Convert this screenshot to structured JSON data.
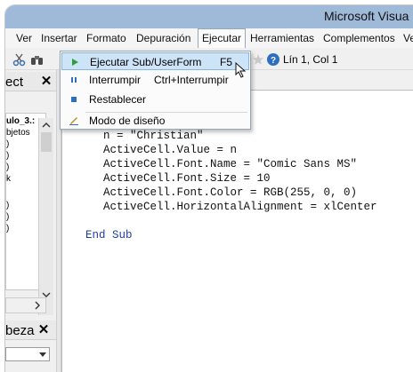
{
  "window": {
    "title": "Microsoft Visua"
  },
  "menubar": {
    "items": [
      {
        "label": "Ver"
      },
      {
        "label": "Insertar"
      },
      {
        "label": "Formato"
      },
      {
        "label": "Depuración"
      },
      {
        "label": "Ejecutar"
      },
      {
        "label": "Herramientas"
      },
      {
        "label": "Complementos"
      },
      {
        "label": "Ve"
      }
    ]
  },
  "toolbar": {
    "position_text": "Lín 1, Col 1"
  },
  "dropdown": {
    "items": [
      {
        "label": "Ejecutar Sub/UserForm",
        "shortcut": "F5"
      },
      {
        "label": "Interrumpir",
        "shortcut": "Ctrl+Interrumpir"
      },
      {
        "label": "Restablecer",
        "shortcut": ""
      },
      {
        "label": "Modo de diseño",
        "shortcut": ""
      }
    ]
  },
  "left_pane": {
    "project_header": "ect",
    "tree_lines": [
      "ulo_3.:",
      "bjetos",
      ")",
      ")",
      ")",
      "k",
      ")",
      ")",
      ")"
    ],
    "props_header": "beza"
  },
  "code": {
    "lines": [
      "n = \"Christian\"",
      "ActiveCell.Value = n",
      "ActiveCell.Font.Name = \"Comic Sans MS\"",
      "ActiveCell.Font.Size = 10",
      "ActiveCell.Font.Color = RGB(255, 0, 0)",
      "ActiveCell.HorizontalAlignment = xlCenter"
    ],
    "end_kw1": "End",
    "end_kw2": "Sub"
  },
  "colors": {
    "titlebar": "#9fb9d9",
    "highlight": "#cde3f7",
    "keyword": "#1f3f9f"
  }
}
